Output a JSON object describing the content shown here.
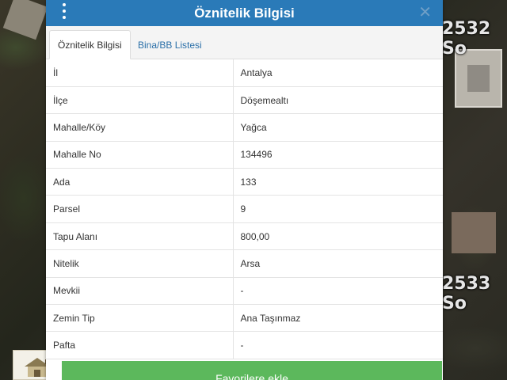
{
  "map": {
    "road_label_1": "2532 So",
    "road_label_2": "2533 So"
  },
  "dialog": {
    "title": "Öznitelik Bilgisi",
    "close_glyph": "✕",
    "tabs": [
      {
        "label": "Öznitelik Bilgisi",
        "active": true
      },
      {
        "label": "Bina/BB Listesi",
        "active": false
      }
    ],
    "rows": [
      {
        "key": "İl",
        "value": "Antalya"
      },
      {
        "key": "İlçe",
        "value": "Döşemealtı"
      },
      {
        "key": "Mahalle/Köy",
        "value": "Yağca"
      },
      {
        "key": "Mahalle No",
        "value": "134496"
      },
      {
        "key": "Ada",
        "value": "133"
      },
      {
        "key": "Parsel",
        "value": "9"
      },
      {
        "key": "Tapu Alanı",
        "value": "800,00"
      },
      {
        "key": "Nitelik",
        "value": "Arsa"
      },
      {
        "key": "Mevkii",
        "value": "-"
      },
      {
        "key": "Zemin Tip",
        "value": "Ana Taşınmaz"
      },
      {
        "key": "Pafta",
        "value": "-"
      }
    ],
    "footer_button": "Favorilere ekle"
  },
  "colors": {
    "header": "#2a7ab8",
    "button": "#5cb85c",
    "tab_link": "#2a6fa8"
  }
}
